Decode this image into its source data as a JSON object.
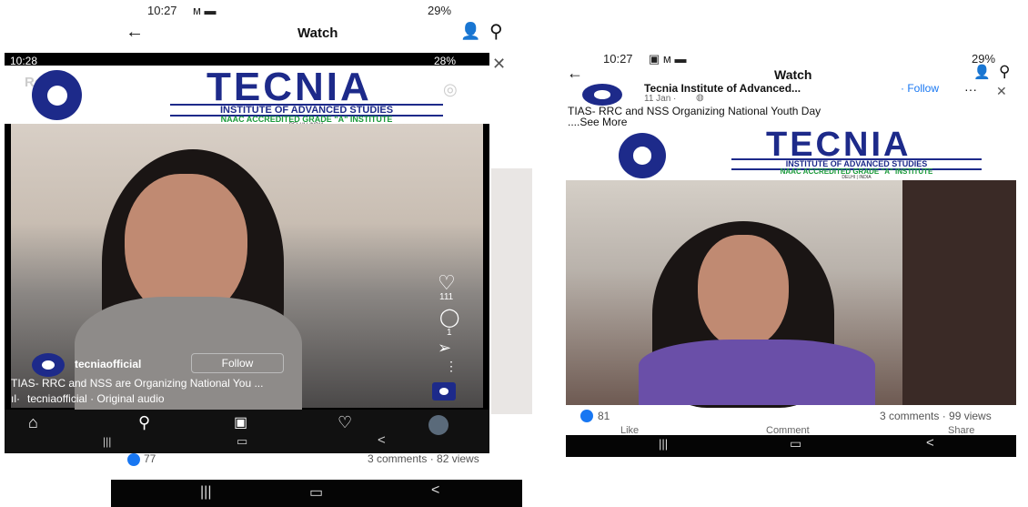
{
  "left_back": {
    "time": "10:27",
    "status_right": "29%",
    "title": "Watch",
    "likes": "77",
    "stats": "3 comments · 82 views"
  },
  "reels": {
    "time": "10:28",
    "status_right": "28%",
    "tab_label": "Reels",
    "account": "tecniaofficial",
    "follow_label": "Follow",
    "caption": "TIAS- RRC and NSS are Organizing National You ...",
    "audio": "tecniaofficial · Original audio",
    "like_count": "111",
    "comment_count": "1"
  },
  "logo": {
    "name": "TECNIA",
    "line1": "INSTITUTE OF ADVANCED STUDIES",
    "line2": "NAAC ACCREDITED GRADE \"A\" INSTITUTE",
    "line3": "DELHI | INDIA"
  },
  "right": {
    "time": "10:27",
    "status_right": "29%",
    "title": "Watch",
    "page_name": "Tecnia Institute of Advanced...",
    "follow": "· Follow",
    "date": "11 Jan · ",
    "post_text": "TIAS- RRC and NSS Organizing National Youth Day",
    "see_more": "....See More",
    "likes": "81",
    "stats": "3 comments · 99 views",
    "actions": [
      "Like",
      "Comment",
      "Share"
    ]
  },
  "colors": {
    "facebook_blue": "#1877f2",
    "logo_blue": "#1d2a8a",
    "logo_green": "#1a9a3a"
  }
}
